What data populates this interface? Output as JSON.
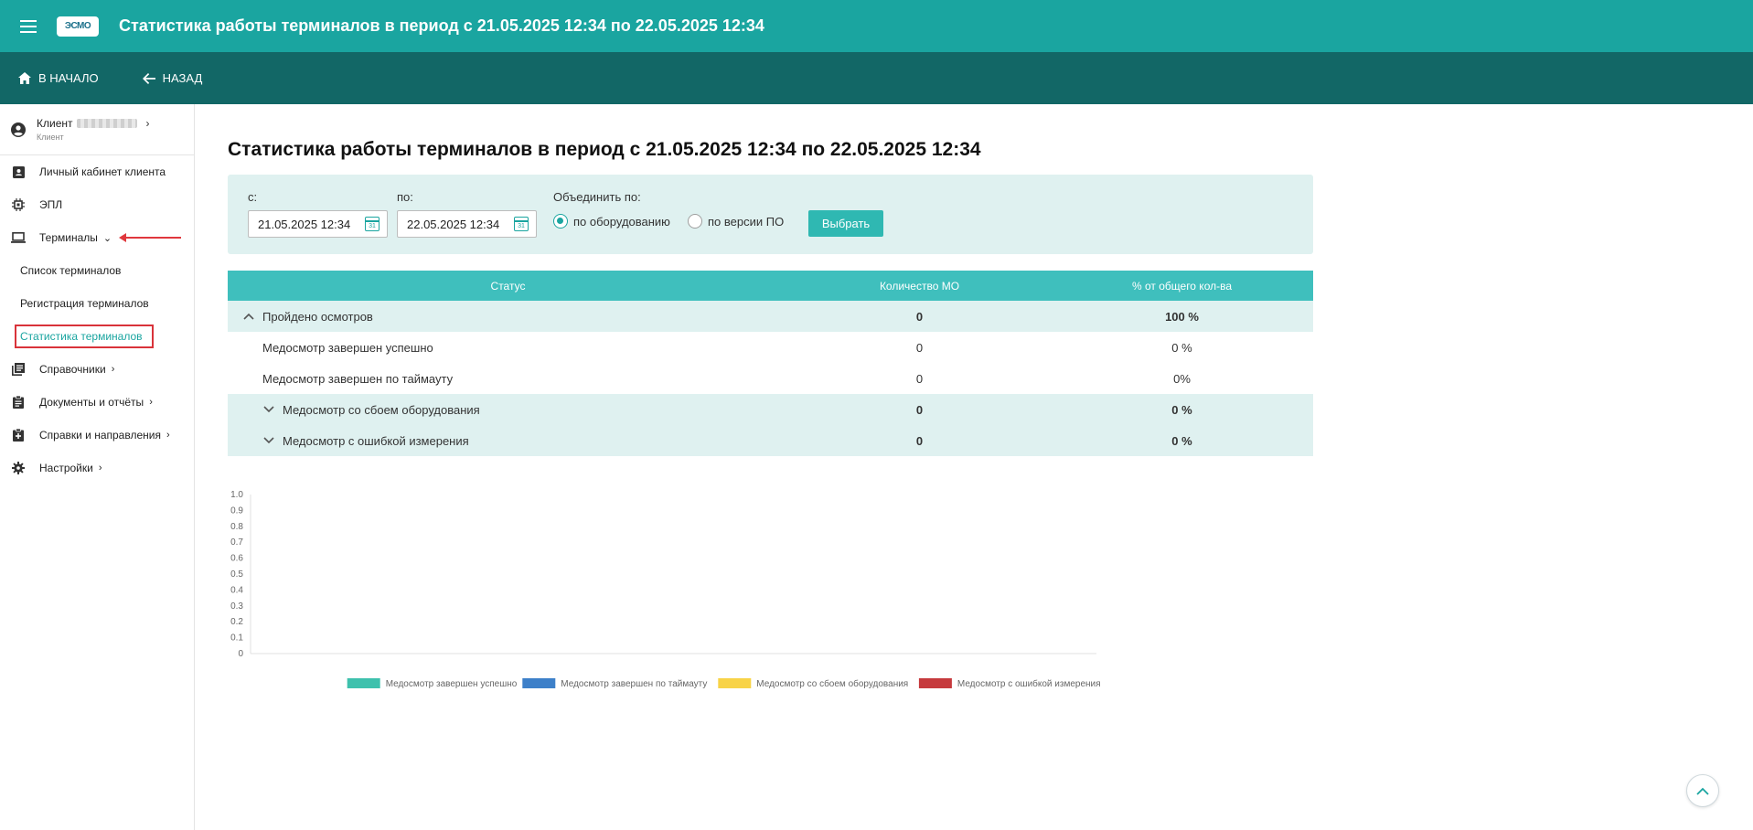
{
  "topbar": {
    "logo_text": "ЭСМО",
    "title": "Статистика работы терминалов в период с 21.05.2025 12:34 по 22.05.2025 12:34"
  },
  "subbar": {
    "home_label": "В НАЧАЛО",
    "back_label": "НАЗАД"
  },
  "sidebar": {
    "client": {
      "name": "Клиент",
      "role": "Клиент"
    },
    "items": [
      {
        "label": "Личный кабинет клиента",
        "icon": "contact-card-icon"
      },
      {
        "label": "ЭПЛ",
        "icon": "chip-icon"
      },
      {
        "label": "Терминалы",
        "icon": "laptop-icon",
        "expanded": true
      },
      {
        "label": "Справочники",
        "icon": "book-icon"
      },
      {
        "label": "Документы и отчёты",
        "icon": "clipboard-icon"
      },
      {
        "label": "Справки и направления",
        "icon": "clipboard-plus-icon"
      },
      {
        "label": "Настройки",
        "icon": "gear-icon"
      }
    ],
    "terminals_sub": [
      {
        "label": "Список терминалов"
      },
      {
        "label": "Регистрация терминалов"
      },
      {
        "label": "Статистика терминалов",
        "active": true
      }
    ]
  },
  "main": {
    "title": "Статистика работы терминалов в период с 21.05.2025 12:34 по 22.05.2025 12:34",
    "filter": {
      "from_label": "с:",
      "from_value": "21.05.2025 12:34",
      "to_label": "по:",
      "to_value": "22.05.2025 12:34",
      "group_label": "Объединить по:",
      "option_equipment": "по оборудованию",
      "option_software": "по версии ПО",
      "selected": "по оборудованию",
      "submit_label": "Выбрать"
    },
    "table": {
      "headers": [
        "Статус",
        "Количество МО",
        "% от общего кол-ва"
      ],
      "rows": [
        {
          "status": "Пройдено осмотров",
          "count": "0",
          "percent": "100 %"
        },
        {
          "status": "Медосмотр завершен успешно",
          "count": "0",
          "percent": "0 %"
        },
        {
          "status": "Медосмотр завершен по таймауту",
          "count": "0",
          "percent": "0%"
        },
        {
          "status": "Медосмотр со сбоем оборудования",
          "count": "0",
          "percent": "0 %"
        },
        {
          "status": "Медосмотр с ошибкой измерения",
          "count": "0",
          "percent": "0 %"
        }
      ]
    }
  },
  "chart_data": {
    "type": "bar",
    "categories": [],
    "series": [
      {
        "name": "Медосмотр завершен успешно",
        "color": "#3ec1ad",
        "values": []
      },
      {
        "name": "Медосмотр завершен по таймауту",
        "color": "#3d80c9",
        "values": []
      },
      {
        "name": "Медосмотр со сбоем оборудования",
        "color": "#f8d347",
        "values": []
      },
      {
        "name": "Медосмотр с ошибкой измерения",
        "color": "#c63a3d",
        "values": []
      }
    ],
    "ylim": [
      0,
      1.0
    ],
    "yticks": [
      "0",
      "0.1",
      "0.2",
      "0.3",
      "0.4",
      "0.5",
      "0.6",
      "0.7",
      "0.8",
      "0.9",
      "1.0"
    ],
    "legend_position": "bottom",
    "grid": false
  }
}
